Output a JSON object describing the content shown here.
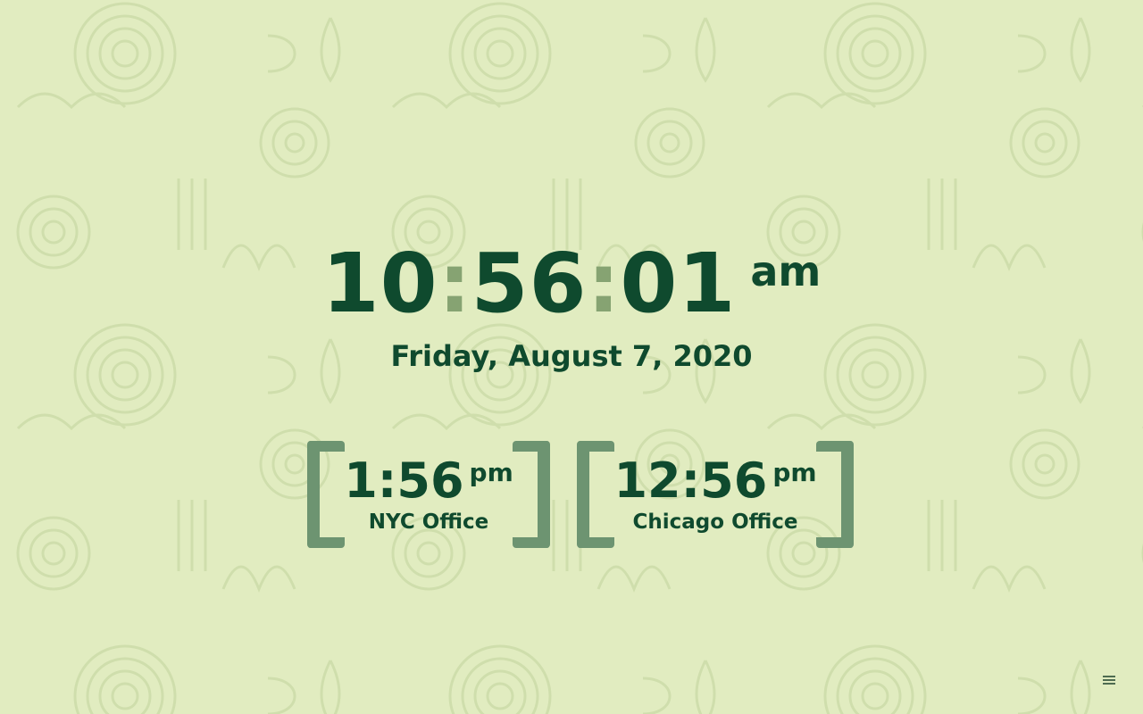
{
  "theme": {
    "background": "#e1ecc0",
    "pattern": "#cddcaa",
    "text": "#0f4a2e",
    "separator": "#86a372",
    "bracket": "#6d9471"
  },
  "clock": {
    "hours": "10",
    "separator": ":",
    "minutes": "56",
    "seconds": "01",
    "period": "am"
  },
  "date": "Friday, August 7, 2020",
  "offices": [
    {
      "time": "1:56",
      "period": "pm",
      "label": "NYC Office"
    },
    {
      "time": "12:56",
      "period": "pm",
      "label": "Chicago Office"
    }
  ],
  "menu": {
    "icon": "hamburger-menu-icon"
  }
}
